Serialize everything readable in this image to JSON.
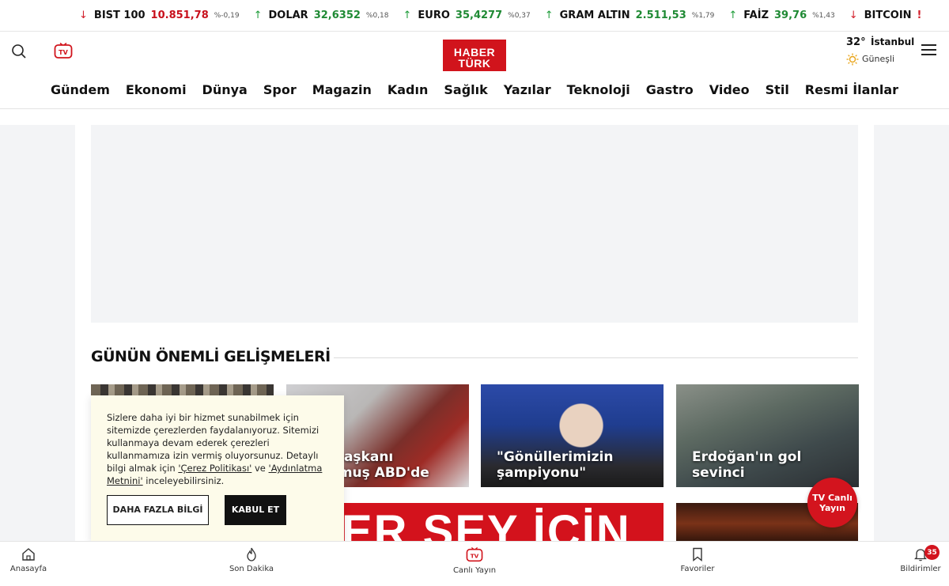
{
  "ticker": [
    {
      "name": "BIST 100",
      "value": "10.851,78",
      "change": "%-0,19",
      "dir": "down"
    },
    {
      "name": "DOLAR",
      "value": "32,6352",
      "change": "%0,18",
      "dir": "up"
    },
    {
      "name": "EURO",
      "value": "35,4277",
      "change": "%0,37",
      "dir": "up"
    },
    {
      "name": "GRAM ALTIN",
      "value": "2.511,53",
      "change": "%1,79",
      "dir": "up"
    },
    {
      "name": "FAİZ",
      "value": "39,76",
      "change": "%1,43",
      "dir": "up"
    },
    {
      "name": "BITCOIN",
      "value": "",
      "change": "",
      "dir": "down",
      "alert": "!"
    }
  ],
  "header": {
    "logo_top": "HABER",
    "logo_bottom": "TÜRK",
    "weather_temp": "32°",
    "weather_city": "İstanbul",
    "weather_cond": "Güneşli"
  },
  "nav": [
    "Gündem",
    "Ekonomi",
    "Dünya",
    "Spor",
    "Magazin",
    "Kadın",
    "Sağlık",
    "Yazılar",
    "Teknoloji",
    "Gastro",
    "Video",
    "Stil",
    "Resmi İlanlar"
  ],
  "section": {
    "title": "GÜNÜN ÖNEMLİ GELİŞMELERİ"
  },
  "cards": [
    {
      "caption": ""
    },
    {
      "caption": "Başkanı\nlmuş ABD'de"
    },
    {
      "caption": "\"Gönüllerimizin şampiyonu\""
    },
    {
      "caption": "Erdoğan'ın gol sevinci"
    }
  ],
  "banner_text": "ER ŞEY İÇİN",
  "tv_live": "TV Canlı Yayın",
  "cookie": {
    "text_1": "Sizlere daha iyi bir hizmet sunabilmek için sitemizde çerezlerden faydalanıyoruz. Sitemizi kullanmaya devam ederek çerezleri kullanmamıza izin vermiş oluyorsunuz. Detaylı bilgi almak için ",
    "link_1": "'Çerez Politikası'",
    "text_2": " ve ",
    "link_2": "'Aydınlatma Metnini'",
    "text_3": " inceleyebilirsiniz.",
    "more_label": "DAHA FAZLA BİLGİ",
    "accept_label": "KABUL ET"
  },
  "bottom_nav": [
    {
      "label": "Anasayfa",
      "icon": "home-icon"
    },
    {
      "label": "Son Dakika",
      "icon": "flame-icon"
    },
    {
      "label": "Canlı Yayın",
      "icon": "tv-icon"
    },
    {
      "label": "Favoriler",
      "icon": "bookmark-icon"
    },
    {
      "label": "Bildirimler",
      "icon": "bell-icon"
    }
  ],
  "notification_count": "35",
  "colors": {
    "brand_red": "#d1141c",
    "up": "#1f8a34",
    "down": "#c8101c"
  }
}
